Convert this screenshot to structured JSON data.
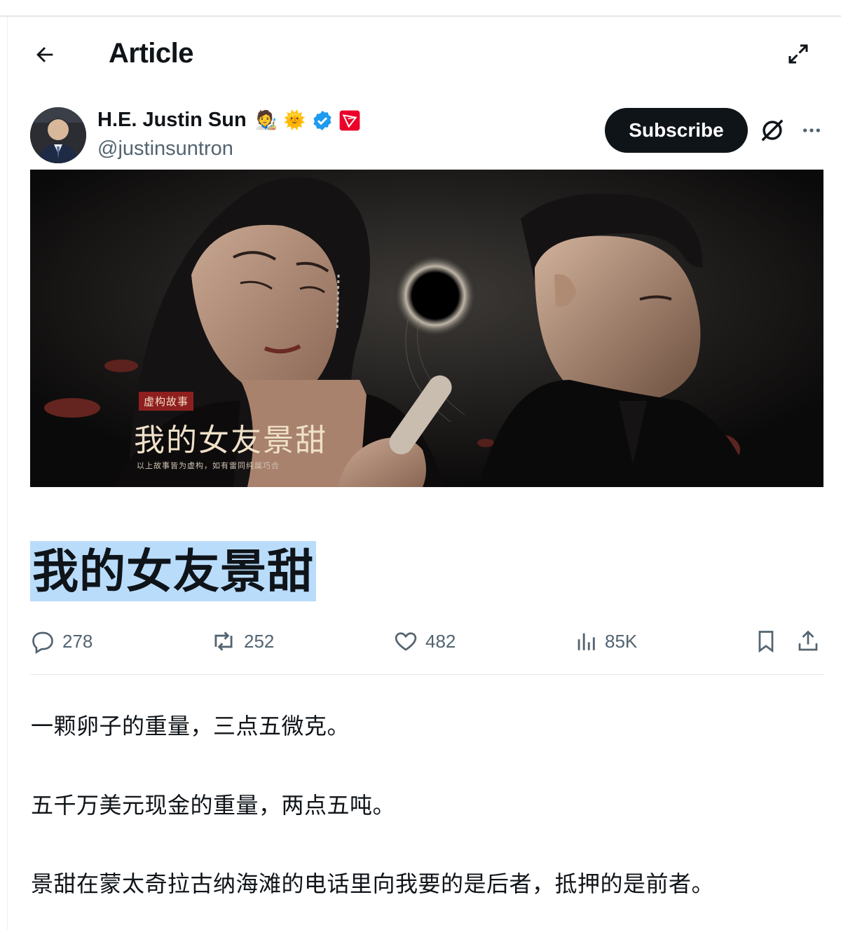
{
  "header": {
    "title": "Article"
  },
  "author": {
    "name": "H.E. Justin Sun",
    "handle": "@justinsuntron",
    "badge_emojis": [
      "🧑‍🎨",
      "🌞"
    ]
  },
  "buttons": {
    "subscribe": "Subscribe"
  },
  "banner": {
    "tag": "虚构故事",
    "title": "我的女友景甜",
    "subtitle": "以上故事皆为虚构，如有雷同纯属巧合"
  },
  "article": {
    "title": "我的女友景甜",
    "paragraphs": [
      "一颗卵子的重量，三点五微克。",
      "五千万美元现金的重量，两点五吨。",
      "景甜在蒙太奇拉古纳海滩的电话里向我要的是后者，抵押的是前者。"
    ]
  },
  "stats": {
    "replies": "278",
    "reposts": "252",
    "likes": "482",
    "views": "85K"
  },
  "colors": {
    "accent": "#1d9bf0",
    "text": "#0f1419",
    "muted": "#536471",
    "highlight": "#b9dcfb",
    "tron_red": "#eb0029"
  }
}
